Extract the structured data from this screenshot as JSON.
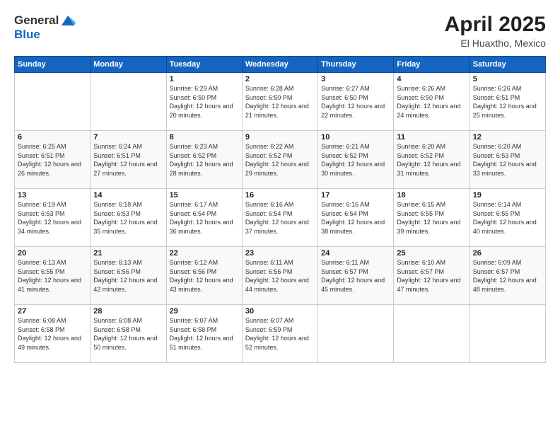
{
  "logo": {
    "general": "General",
    "blue": "Blue"
  },
  "title": "April 2025",
  "subtitle": "El Huaxtho, Mexico",
  "weekdays": [
    "Sunday",
    "Monday",
    "Tuesday",
    "Wednesday",
    "Thursday",
    "Friday",
    "Saturday"
  ],
  "weeks": [
    [
      {
        "day": "",
        "info": ""
      },
      {
        "day": "",
        "info": ""
      },
      {
        "day": "1",
        "info": "Sunrise: 6:29 AM\nSunset: 6:50 PM\nDaylight: 12 hours and 20 minutes."
      },
      {
        "day": "2",
        "info": "Sunrise: 6:28 AM\nSunset: 6:50 PM\nDaylight: 12 hours and 21 minutes."
      },
      {
        "day": "3",
        "info": "Sunrise: 6:27 AM\nSunset: 6:50 PM\nDaylight: 12 hours and 22 minutes."
      },
      {
        "day": "4",
        "info": "Sunrise: 6:26 AM\nSunset: 6:50 PM\nDaylight: 12 hours and 24 minutes."
      },
      {
        "day": "5",
        "info": "Sunrise: 6:26 AM\nSunset: 6:51 PM\nDaylight: 12 hours and 25 minutes."
      }
    ],
    [
      {
        "day": "6",
        "info": "Sunrise: 6:25 AM\nSunset: 6:51 PM\nDaylight: 12 hours and 26 minutes."
      },
      {
        "day": "7",
        "info": "Sunrise: 6:24 AM\nSunset: 6:51 PM\nDaylight: 12 hours and 27 minutes."
      },
      {
        "day": "8",
        "info": "Sunrise: 6:23 AM\nSunset: 6:52 PM\nDaylight: 12 hours and 28 minutes."
      },
      {
        "day": "9",
        "info": "Sunrise: 6:22 AM\nSunset: 6:52 PM\nDaylight: 12 hours and 29 minutes."
      },
      {
        "day": "10",
        "info": "Sunrise: 6:21 AM\nSunset: 6:52 PM\nDaylight: 12 hours and 30 minutes."
      },
      {
        "day": "11",
        "info": "Sunrise: 6:20 AM\nSunset: 6:52 PM\nDaylight: 12 hours and 31 minutes."
      },
      {
        "day": "12",
        "info": "Sunrise: 6:20 AM\nSunset: 6:53 PM\nDaylight: 12 hours and 33 minutes."
      }
    ],
    [
      {
        "day": "13",
        "info": "Sunrise: 6:19 AM\nSunset: 6:53 PM\nDaylight: 12 hours and 34 minutes."
      },
      {
        "day": "14",
        "info": "Sunrise: 6:18 AM\nSunset: 6:53 PM\nDaylight: 12 hours and 35 minutes."
      },
      {
        "day": "15",
        "info": "Sunrise: 6:17 AM\nSunset: 6:54 PM\nDaylight: 12 hours and 36 minutes."
      },
      {
        "day": "16",
        "info": "Sunrise: 6:16 AM\nSunset: 6:54 PM\nDaylight: 12 hours and 37 minutes."
      },
      {
        "day": "17",
        "info": "Sunrise: 6:16 AM\nSunset: 6:54 PM\nDaylight: 12 hours and 38 minutes."
      },
      {
        "day": "18",
        "info": "Sunrise: 6:15 AM\nSunset: 6:55 PM\nDaylight: 12 hours and 39 minutes."
      },
      {
        "day": "19",
        "info": "Sunrise: 6:14 AM\nSunset: 6:55 PM\nDaylight: 12 hours and 40 minutes."
      }
    ],
    [
      {
        "day": "20",
        "info": "Sunrise: 6:13 AM\nSunset: 6:55 PM\nDaylight: 12 hours and 41 minutes."
      },
      {
        "day": "21",
        "info": "Sunrise: 6:13 AM\nSunset: 6:56 PM\nDaylight: 12 hours and 42 minutes."
      },
      {
        "day": "22",
        "info": "Sunrise: 6:12 AM\nSunset: 6:56 PM\nDaylight: 12 hours and 43 minutes."
      },
      {
        "day": "23",
        "info": "Sunrise: 6:11 AM\nSunset: 6:56 PM\nDaylight: 12 hours and 44 minutes."
      },
      {
        "day": "24",
        "info": "Sunrise: 6:11 AM\nSunset: 6:57 PM\nDaylight: 12 hours and 45 minutes."
      },
      {
        "day": "25",
        "info": "Sunrise: 6:10 AM\nSunset: 6:57 PM\nDaylight: 12 hours and 47 minutes."
      },
      {
        "day": "26",
        "info": "Sunrise: 6:09 AM\nSunset: 6:57 PM\nDaylight: 12 hours and 48 minutes."
      }
    ],
    [
      {
        "day": "27",
        "info": "Sunrise: 6:08 AM\nSunset: 6:58 PM\nDaylight: 12 hours and 49 minutes."
      },
      {
        "day": "28",
        "info": "Sunrise: 6:08 AM\nSunset: 6:58 PM\nDaylight: 12 hours and 50 minutes."
      },
      {
        "day": "29",
        "info": "Sunrise: 6:07 AM\nSunset: 6:58 PM\nDaylight: 12 hours and 51 minutes."
      },
      {
        "day": "30",
        "info": "Sunrise: 6:07 AM\nSunset: 6:59 PM\nDaylight: 12 hours and 52 minutes."
      },
      {
        "day": "",
        "info": ""
      },
      {
        "day": "",
        "info": ""
      },
      {
        "day": "",
        "info": ""
      }
    ]
  ]
}
